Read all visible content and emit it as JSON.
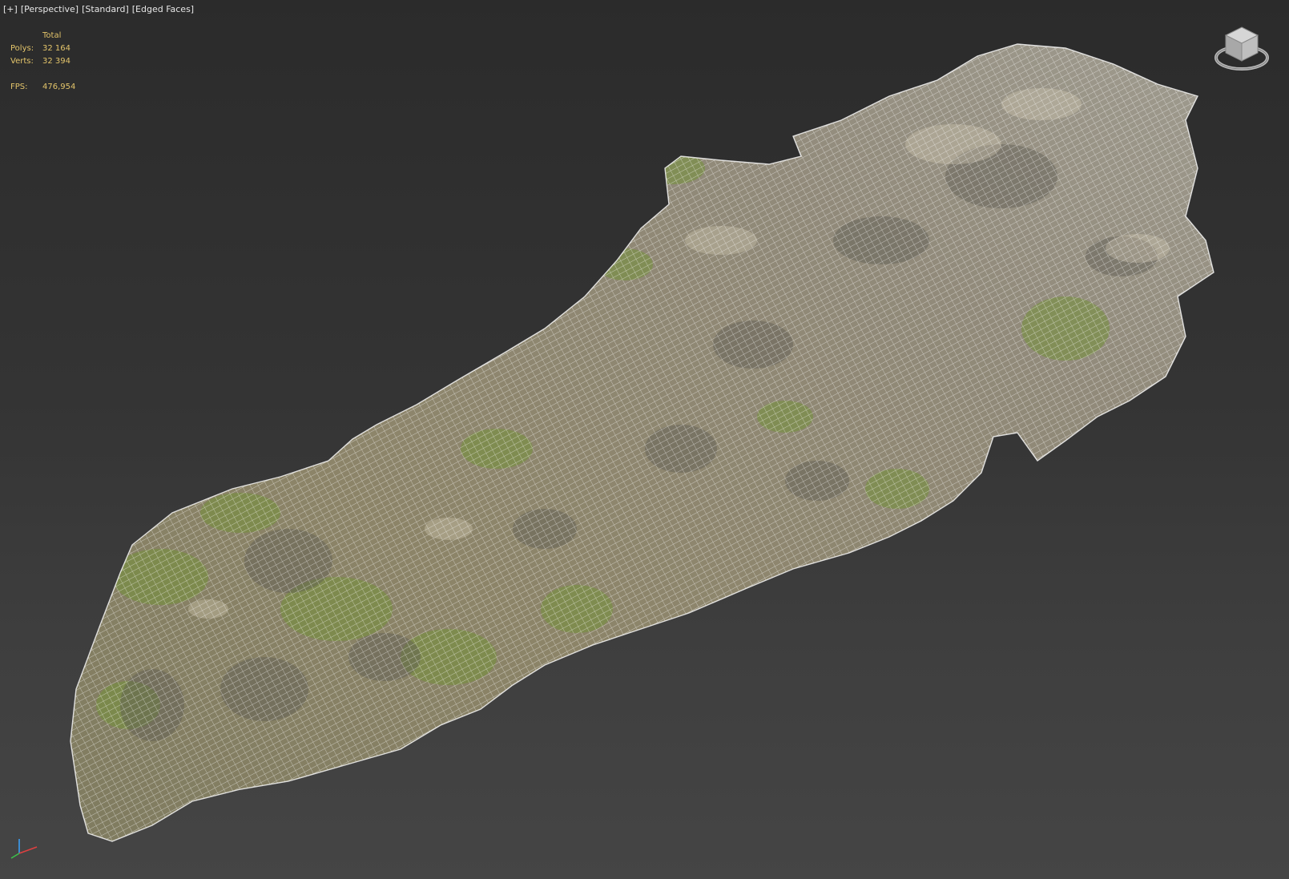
{
  "viewport": {
    "menu": {
      "plus": "[+]",
      "view": "[Perspective]",
      "shading": "[Standard]",
      "display": "[Edged Faces]"
    },
    "stats": {
      "header": "Total",
      "polys_label": "Polys:",
      "polys_value": "32 164",
      "verts_label": "Verts:",
      "verts_value": "32 394",
      "fps_label": "FPS:",
      "fps_value": "476,954"
    },
    "icons": {
      "viewcube": "viewcube-icon",
      "axis": "axis-tripod-icon"
    },
    "colors": {
      "stats_text": "#e3c46a",
      "menu_text": "#e6e6e6",
      "wire": "#ffffff",
      "rock_base": "#8a8270",
      "moss": "#7e9a3c"
    }
  }
}
